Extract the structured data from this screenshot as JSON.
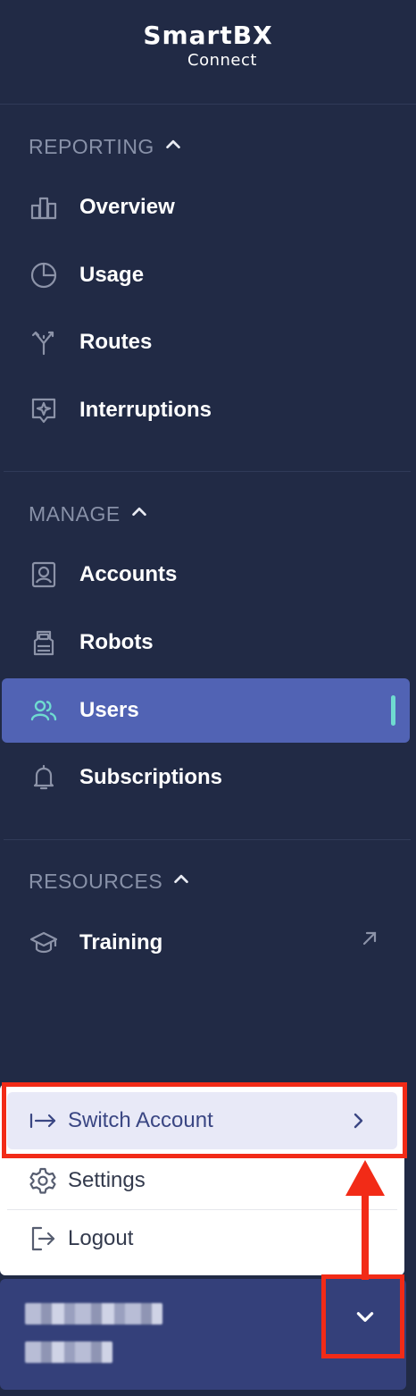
{
  "logo": {
    "main": "SmartBX",
    "sub": "Connect"
  },
  "sections": {
    "reporting": {
      "label": "REPORTING",
      "items": [
        {
          "label": "Overview",
          "icon": "bar-chart-icon"
        },
        {
          "label": "Usage",
          "icon": "pie-chart-icon"
        },
        {
          "label": "Routes",
          "icon": "split-arrow-icon"
        },
        {
          "label": "Interruptions",
          "icon": "alert-badge-icon"
        }
      ]
    },
    "manage": {
      "label": "MANAGE",
      "items": [
        {
          "label": "Accounts",
          "icon": "account-icon"
        },
        {
          "label": "Robots",
          "icon": "robot-icon"
        },
        {
          "label": "Users",
          "icon": "users-icon",
          "active": true
        },
        {
          "label": "Subscriptions",
          "icon": "bell-icon"
        }
      ]
    },
    "resources": {
      "label": "RESOURCES",
      "items": [
        {
          "label": "Training",
          "icon": "graduation-cap-icon",
          "external": true
        }
      ]
    }
  },
  "user_menu": {
    "switch_account": "Switch Account",
    "settings": "Settings",
    "logout": "Logout"
  },
  "colors": {
    "sidebar_bg": "#212a45",
    "active_bg": "#5163b4",
    "active_indicator": "#6fdbd0",
    "highlight_annotation": "#f22b17",
    "user_card_bg": "#34407a"
  }
}
